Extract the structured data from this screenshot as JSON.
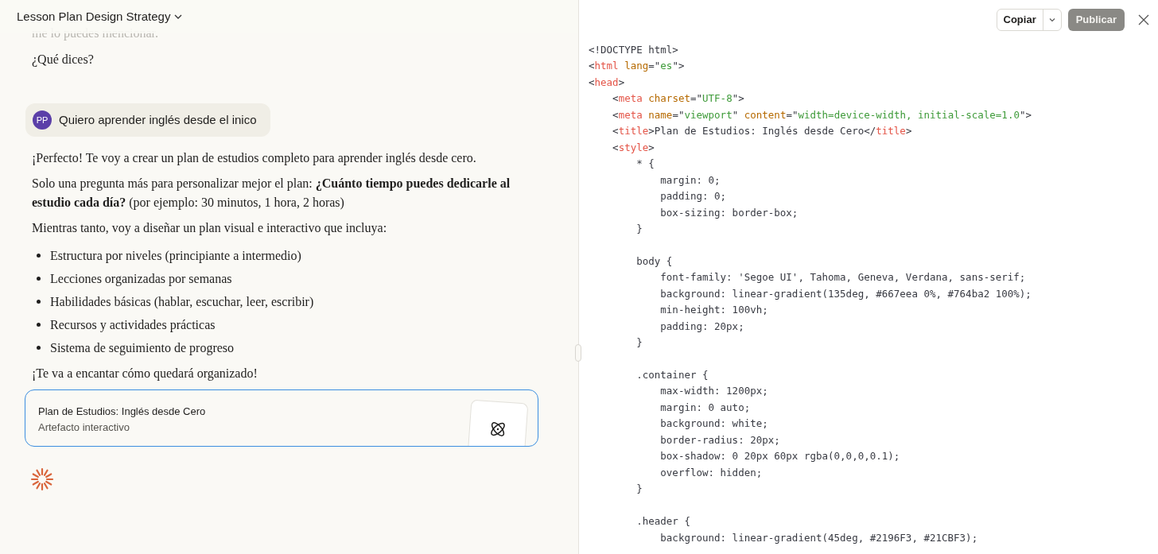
{
  "chat": {
    "title": "Lesson Plan Design Strategy",
    "faded_line": "me lo puedes mencionar.",
    "before": [
      "¿Qué dices?"
    ],
    "user_message": {
      "avatar": "PP",
      "text": "Quiero aprender inglés desde el inico"
    },
    "reply": [
      {
        "kind": "paragraph",
        "text": "¡Perfecto! Te voy a crear un plan de estudios completo para aprender inglés desde cero."
      },
      {
        "kind": "paragraph",
        "text": "Solo una pregunta más para personalizar mejor el plan: **¿Cuánto tiempo puedes dedicarle al estudio cada día?** (por ejemplo: 30 minutos, 1 hora, 2 horas)"
      },
      {
        "kind": "paragraph",
        "text": "Mientras tanto, voy a diseñar un plan visual e interactivo que incluya:"
      },
      {
        "kind": "list",
        "items": [
          "Estructura por niveles (principiante a intermedio)",
          "Lecciones organizadas por semanas",
          "Habilidades básicas (hablar, escuchar, leer, escribir)",
          "Recursos y actividades prácticas",
          "Sistema de seguimiento de progreso"
        ]
      },
      {
        "kind": "paragraph",
        "text": "¡Te va a encantar cómo quedará organizado!"
      }
    ],
    "artifact": {
      "title": "Plan de Estudios: Inglés desde Cero",
      "subtitle": "Artefacto interactivo",
      "selected": true
    }
  },
  "code_panel": {
    "copy_button": "Copiar",
    "publish_button": {
      "label": "Publicar",
      "disabled": true
    },
    "lines": [
      {
        "kind": "code",
        "tokens": [
          {
            "kind": "punct",
            "text": "<!DOCTYPE html>"
          }
        ]
      },
      {
        "kind": "code",
        "tokens": [
          {
            "kind": "punct",
            "text": "<"
          },
          {
            "kind": "tag",
            "text": "html"
          },
          {
            "kind": "attr",
            "text": " lang"
          },
          {
            "kind": "punct",
            "text": "=\""
          },
          {
            "kind": "string",
            "text": "es"
          },
          {
            "kind": "punct",
            "text": "\">"
          }
        ]
      },
      {
        "kind": "code",
        "tokens": [
          {
            "kind": "punct",
            "text": "<"
          },
          {
            "kind": "tag",
            "text": "head"
          },
          {
            "kind": "punct",
            "text": ">"
          }
        ]
      },
      {
        "kind": "code",
        "tokens": [
          {
            "kind": "punct",
            "text": "    <"
          },
          {
            "kind": "tag",
            "text": "meta"
          },
          {
            "kind": "attr",
            "text": " charset"
          },
          {
            "kind": "punct",
            "text": "=\""
          },
          {
            "kind": "string",
            "text": "UTF-8"
          },
          {
            "kind": "punct",
            "text": "\">"
          }
        ]
      },
      {
        "kind": "code",
        "tokens": [
          {
            "kind": "punct",
            "text": "    <"
          },
          {
            "kind": "tag",
            "text": "meta"
          },
          {
            "kind": "attr",
            "text": " name"
          },
          {
            "kind": "punct",
            "text": "=\""
          },
          {
            "kind": "string",
            "text": "viewport"
          },
          {
            "kind": "punct",
            "text": "\""
          },
          {
            "kind": "attr",
            "text": " content"
          },
          {
            "kind": "punct",
            "text": "=\""
          },
          {
            "kind": "string",
            "text": "width=device-width, initial-scale=1.0"
          },
          {
            "kind": "punct",
            "text": "\">"
          }
        ]
      },
      {
        "kind": "code",
        "tokens": [
          {
            "kind": "punct",
            "text": "    <"
          },
          {
            "kind": "tag",
            "text": "title"
          },
          {
            "kind": "punct",
            "text": ">Plan de Estudios: Inglés desde Cero</"
          },
          {
            "kind": "tag",
            "text": "title"
          },
          {
            "kind": "punct",
            "text": ">"
          }
        ]
      },
      {
        "kind": "code",
        "tokens": [
          {
            "kind": "punct",
            "text": "    <"
          },
          {
            "kind": "tag",
            "text": "style"
          },
          {
            "kind": "punct",
            "text": ">"
          }
        ]
      },
      {
        "kind": "code",
        "tokens": [
          {
            "kind": "punct",
            "text": "        * {"
          }
        ]
      },
      {
        "kind": "code",
        "tokens": [
          {
            "kind": "punct",
            "text": "            margin: 0;"
          }
        ]
      },
      {
        "kind": "code",
        "tokens": [
          {
            "kind": "punct",
            "text": "            padding: 0;"
          }
        ]
      },
      {
        "kind": "code",
        "tokens": [
          {
            "kind": "punct",
            "text": "            box-sizing: border-box;"
          }
        ]
      },
      {
        "kind": "code",
        "tokens": [
          {
            "kind": "punct",
            "text": "        }"
          }
        ]
      },
      {
        "kind": "blank"
      },
      {
        "kind": "code",
        "tokens": [
          {
            "kind": "punct",
            "text": "        body {"
          }
        ]
      },
      {
        "kind": "code",
        "tokens": [
          {
            "kind": "punct",
            "text": "            font-family: 'Segoe UI', Tahoma, Geneva, Verdana, sans-serif;"
          }
        ]
      },
      {
        "kind": "code",
        "tokens": [
          {
            "kind": "punct",
            "text": "            background: linear-gradient(135deg, #667eea 0%, #764ba2 100%);"
          }
        ]
      },
      {
        "kind": "code",
        "tokens": [
          {
            "kind": "punct",
            "text": "            min-height: 100vh;"
          }
        ]
      },
      {
        "kind": "code",
        "tokens": [
          {
            "kind": "punct",
            "text": "            padding: 20px;"
          }
        ]
      },
      {
        "kind": "code",
        "tokens": [
          {
            "kind": "punct",
            "text": "        }"
          }
        ]
      },
      {
        "kind": "blank"
      },
      {
        "kind": "code",
        "tokens": [
          {
            "kind": "punct",
            "text": "        .container {"
          }
        ]
      },
      {
        "kind": "code",
        "tokens": [
          {
            "kind": "punct",
            "text": "            max-width: 1200px;"
          }
        ]
      },
      {
        "kind": "code",
        "tokens": [
          {
            "kind": "punct",
            "text": "            margin: 0 auto;"
          }
        ]
      },
      {
        "kind": "code",
        "tokens": [
          {
            "kind": "punct",
            "text": "            background: white;"
          }
        ]
      },
      {
        "kind": "code",
        "tokens": [
          {
            "kind": "punct",
            "text": "            border-radius: 20px;"
          }
        ]
      },
      {
        "kind": "code",
        "tokens": [
          {
            "kind": "punct",
            "text": "            box-shadow: 0 20px 60px rgba(0,0,0,0.1);"
          }
        ]
      },
      {
        "kind": "code",
        "tokens": [
          {
            "kind": "punct",
            "text": "            overflow: hidden;"
          }
        ]
      },
      {
        "kind": "code",
        "tokens": [
          {
            "kind": "punct",
            "text": "        }"
          }
        ]
      },
      {
        "kind": "blank"
      },
      {
        "kind": "code",
        "tokens": [
          {
            "kind": "punct",
            "text": "        .header {"
          }
        ]
      },
      {
        "kind": "code",
        "tokens": [
          {
            "kind": "punct",
            "text": "            background: linear-gradient(45deg, #2196F3, #21CBF3);"
          }
        ]
      }
    ]
  }
}
